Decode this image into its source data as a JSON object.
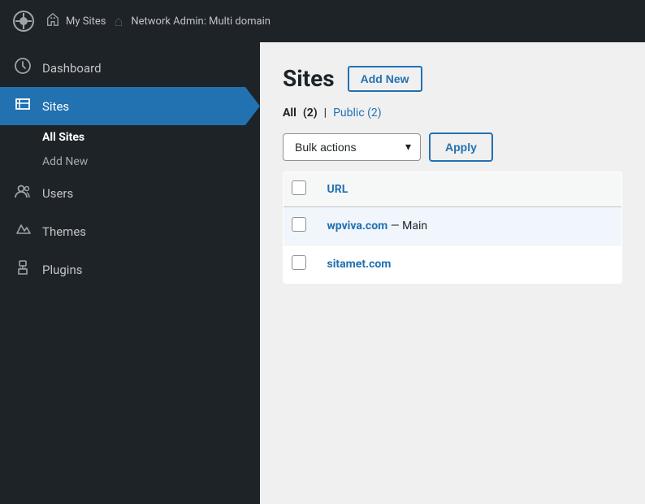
{
  "topbar": {
    "wp_logo": "⊞",
    "my_sites_label": "My Sites",
    "network_admin_label": "Network Admin: Multi domain",
    "my_sites_icon": "🏠",
    "network_icon": "🏠"
  },
  "sidebar": {
    "dashboard_label": "Dashboard",
    "sites_label": "Sites",
    "all_sites_label": "All Sites",
    "add_new_label": "Add New",
    "users_label": "Users",
    "themes_label": "Themes",
    "plugins_label": "Plugins"
  },
  "content": {
    "page_title": "Sites",
    "add_new_button": "Add New",
    "filter": {
      "all_label": "All",
      "all_count": "(2)",
      "separator": "|",
      "public_label": "Public",
      "public_count": "(2)"
    },
    "toolbar": {
      "bulk_actions_label": "Bulk actions",
      "apply_label": "Apply"
    },
    "table": {
      "url_column": "URL",
      "sites": [
        {
          "url": "wpviva.com",
          "suffix": "— Main",
          "highlighted": true,
          "checked": false
        },
        {
          "url": "sitamet.com",
          "suffix": "",
          "highlighted": false,
          "checked": false
        }
      ]
    }
  }
}
